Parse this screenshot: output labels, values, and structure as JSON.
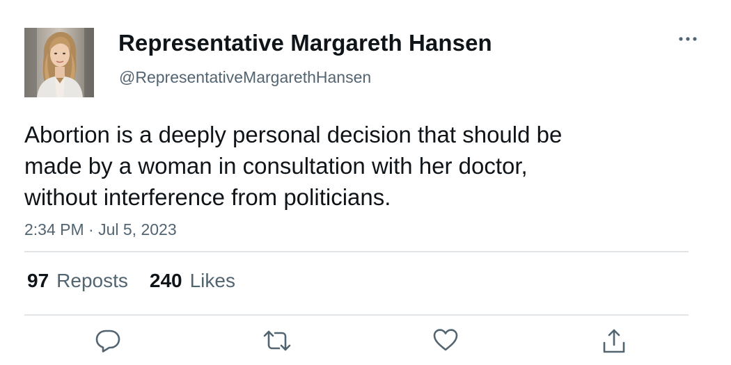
{
  "author": {
    "display_name": "Representative Margareth Hansen",
    "handle": "@RepresentativeMargarethHansen",
    "avatar": "profile-photo"
  },
  "tweet": {
    "text_lines": [
      "Abortion is a deeply personal decision that should be",
      "made by a woman in consultation with her doctor,",
      "without interference from politicians."
    ],
    "timestamp": "2:34 PM · Jul 5, 2023"
  },
  "stats": {
    "reposts_count": "97",
    "reposts_label": "Reposts",
    "likes_count": "240",
    "likes_label": "Likes"
  },
  "actions": [
    {
      "icon": "reply-icon"
    },
    {
      "icon": "repost-icon"
    },
    {
      "icon": "like-icon"
    },
    {
      "icon": "share-icon"
    }
  ],
  "menu": {
    "icon": "more-options-icon"
  },
  "colors": {
    "text_primary": "#0f1419",
    "text_secondary": "#536471",
    "divider": "#e1e5e8",
    "icon": "#536471"
  }
}
